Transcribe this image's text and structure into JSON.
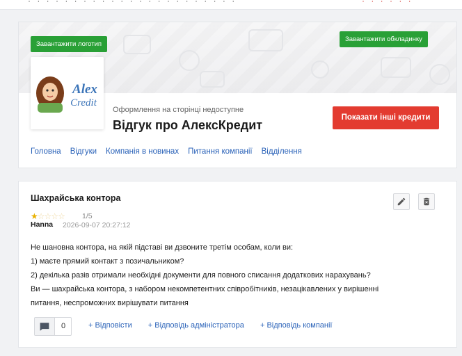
{
  "header": {
    "upload_logo": "Завантажити логотип",
    "upload_cover": "Завантажити обкладинку",
    "logo_text": "AlexCredit",
    "design_note": "Оформлення на сторінці недоступне",
    "title": "Відгук про АлексКредит",
    "other_credits": "Показати інші кредити"
  },
  "nav": {
    "items": [
      "Головна",
      "Відгуки",
      "Компанія в новинах",
      "Питання компанії",
      "Відділення"
    ]
  },
  "review": {
    "title": "Шахрайська контора",
    "rating": "1/5",
    "stars_filled": 1,
    "stars_total": 5,
    "author": "Hanna",
    "date": "2026-09-07 20:27:12",
    "lines": [
      "Не шановна контора, на якій підставі ви дзвоните третім особам, коли ви:",
      "1) маєте прямий контакт з позичальником?",
      "2) декілька разів отримали необхідні документи для повного списання додаткових нарахувань?",
      "Ви — шахрайська контора, з набором некомпетентних співробітників, незацікавлених у вирішенні",
      "питання, неспроможних вирішувати питання"
    ],
    "comment_count": "0",
    "reply": "+ Відповісти",
    "reply_admin": "+ Відповідь адміністратора",
    "reply_company": "+ Відповідь компанії"
  },
  "colors": {
    "green": "#29a036",
    "red": "#e33b30",
    "link": "#2a62b8",
    "star": "#e8b100"
  }
}
